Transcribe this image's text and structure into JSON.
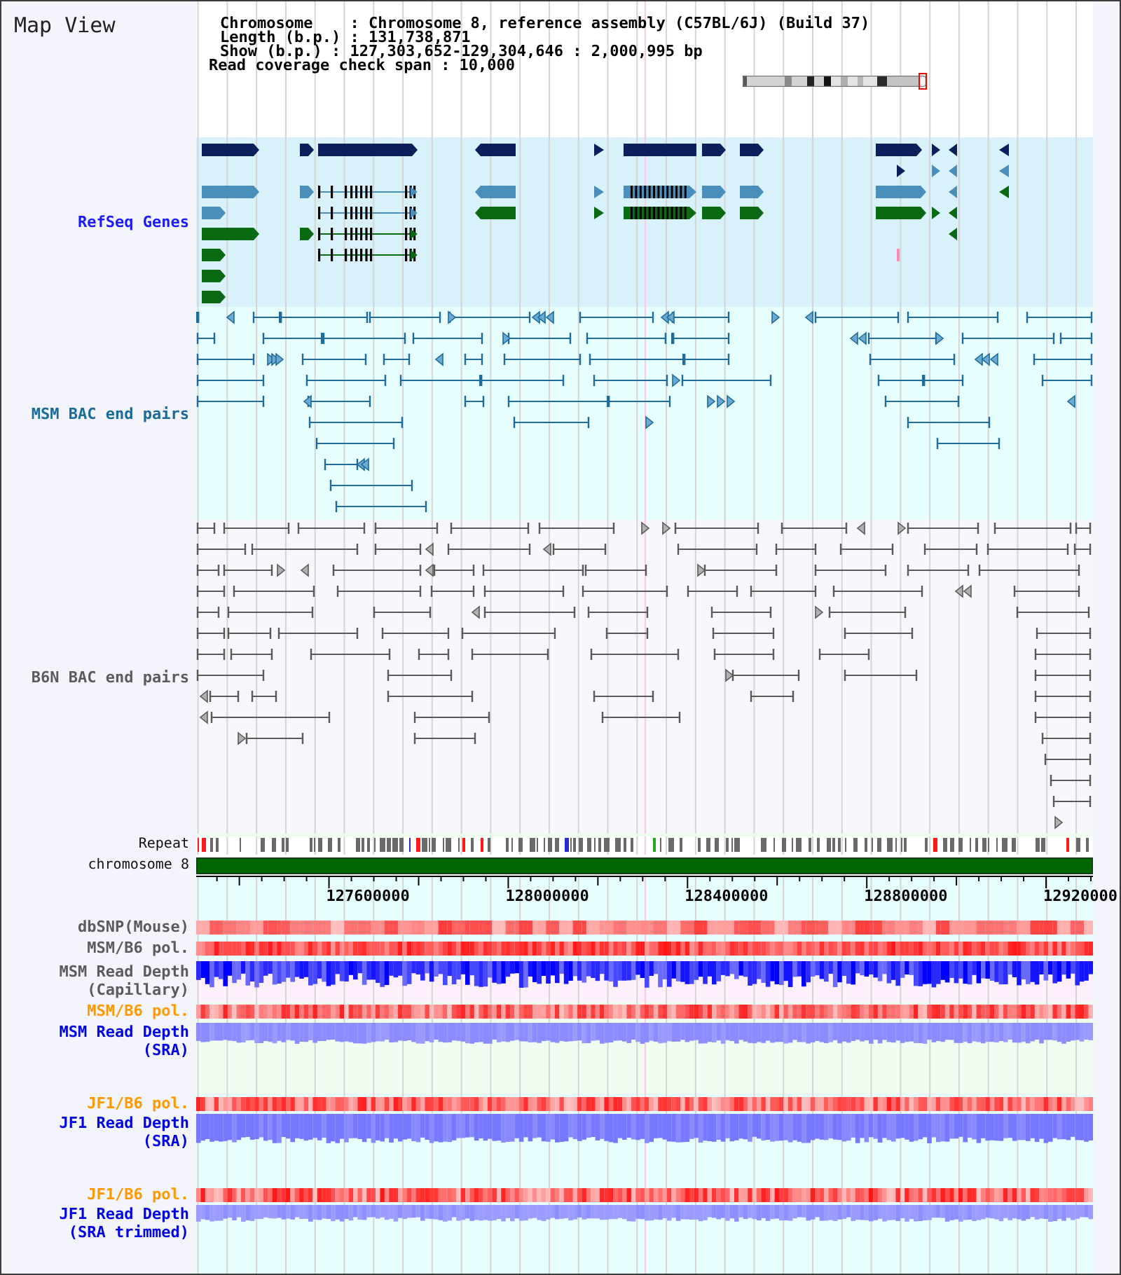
{
  "title": "Map View",
  "info": {
    "lines": [
      "Chromosome    : Chromosome 8, reference assembly (C57BL/6J) (Build 37)",
      "Length (b.p.) : 131,738,871",
      "Show (b.p.) : 127,303,652-129,304,646 : 2,000,995 bp"
    ],
    "coverage": "Read coverage check span : 10,000"
  },
  "feature_tracks": [
    {
      "kind": "genes",
      "label": "RefSeq Genes",
      "color": "#1a1aff"
    },
    {
      "kind": "pairs",
      "label": "MSM BAC end pairs",
      "color": "#1a6a9a"
    },
    {
      "kind": "pairs",
      "label": "B6N BAC end pairs",
      "color": "#5c5c5c"
    }
  ],
  "repeat": {
    "label": "Repeat"
  },
  "chromosome": {
    "label": "chromosome 8"
  },
  "axis": {
    "labels": [
      "127600000",
      "128000000",
      "128400000",
      "128800000",
      "12920000"
    ]
  },
  "data_tracks": [
    {
      "kind": "heat",
      "label": "dbSNP(Mouse)",
      "color": "#5c5c5c"
    },
    {
      "kind": "heat",
      "label": "MSM/B6 pol.",
      "color": "#5c5c5c"
    },
    {
      "kind": "depth",
      "label": "MSM Read Depth (Capillary)",
      "color": "#5c5c5c"
    },
    {
      "kind": "heat",
      "label": "MSM/B6 pol.",
      "color": "#ff9900"
    },
    {
      "kind": "depth",
      "label": "MSM Read Depth (SRA)",
      "color": "#0000e6"
    },
    {
      "kind": "heat",
      "label": "JF1/B6 pol.",
      "color": "#ff9900"
    },
    {
      "kind": "depth",
      "label": "JF1 Read Depth (SRA)",
      "color": "#0000e6"
    },
    {
      "kind": "heat",
      "label": "JF1/B6 pol.",
      "color": "#ff9900"
    },
    {
      "kind": "depth",
      "label": "JF1 Read Depth (SRA trimmed)",
      "color": "#0000e6"
    }
  ]
}
